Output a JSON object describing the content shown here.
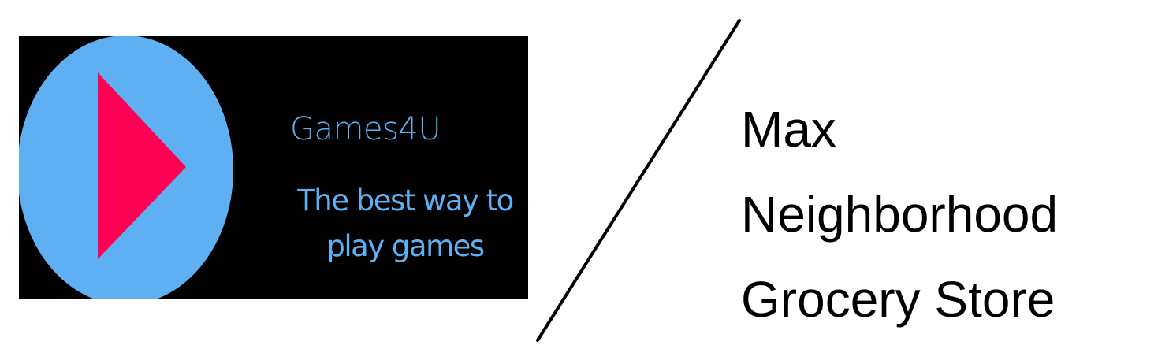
{
  "logo": {
    "name": "Games4U",
    "tagline_line1": "The best way to",
    "tagline_line2": "play games",
    "colors": {
      "background": "#000000",
      "circle": "#5fb0f2",
      "triangle": "#ff0055",
      "text": "#5fb0f2"
    },
    "icon": "play-icon"
  },
  "store": {
    "line1": "Max",
    "line2": "Neighborhood",
    "line3": "Grocery Store"
  }
}
